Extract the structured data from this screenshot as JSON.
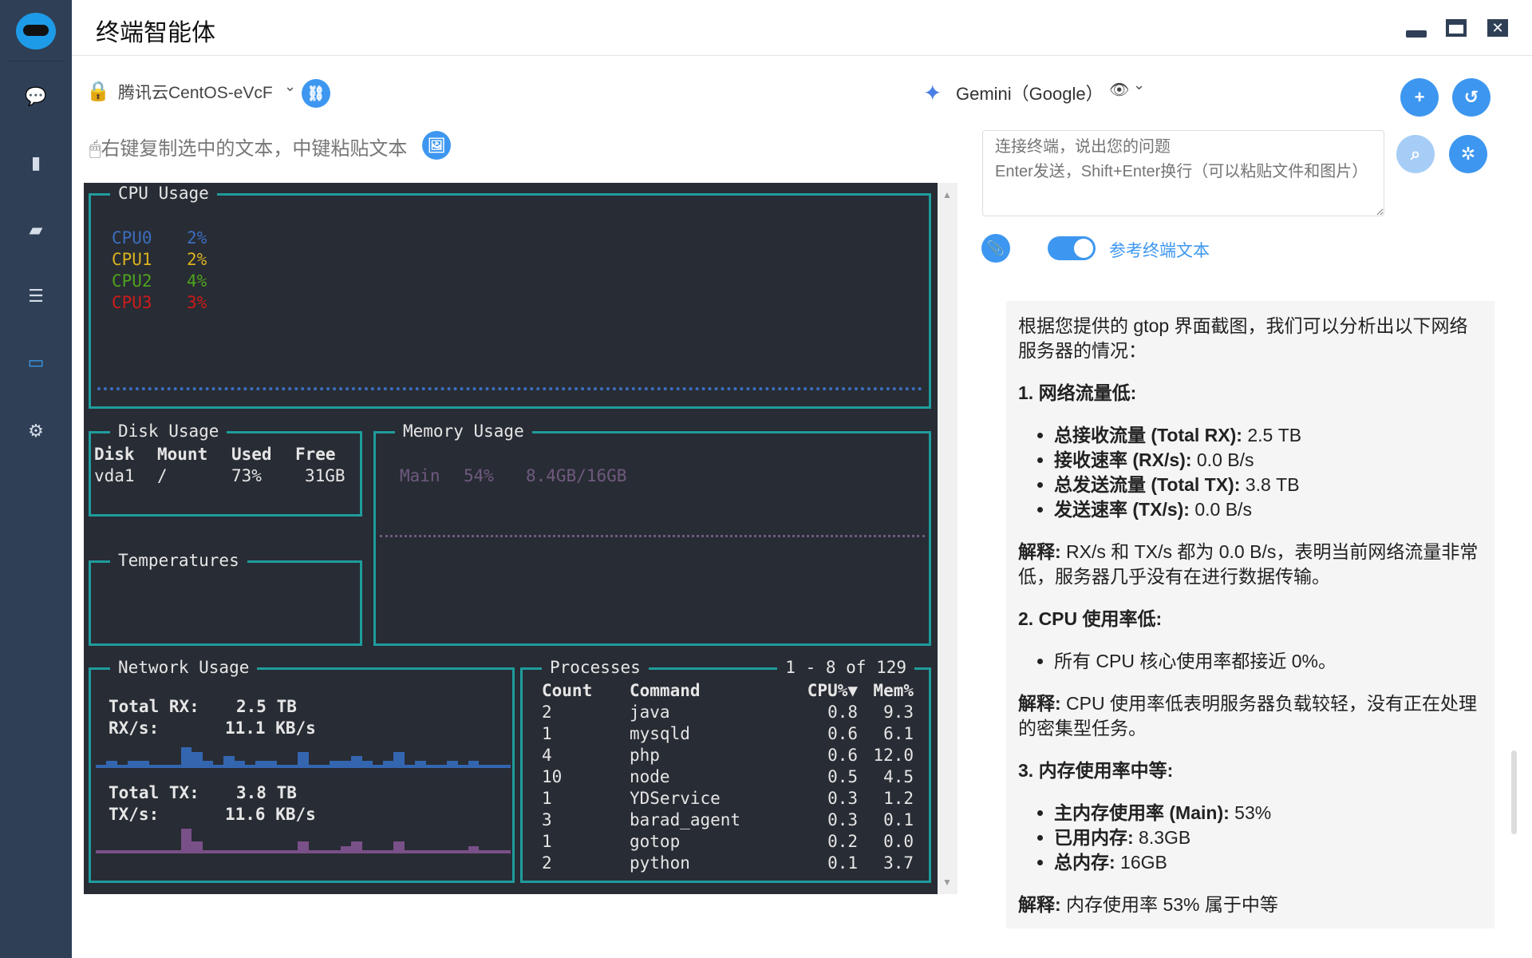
{
  "app": {
    "title": "终端智能体"
  },
  "sidebar": {
    "items": [
      {
        "name": "chat",
        "icon": "chat-icon",
        "glyph": "💬"
      },
      {
        "name": "file",
        "icon": "file-icon",
        "glyph": "▮"
      },
      {
        "name": "book",
        "icon": "book-icon",
        "glyph": "▰"
      },
      {
        "name": "database",
        "icon": "database-icon",
        "glyph": "☰"
      },
      {
        "name": "terminal",
        "icon": "monitor-icon",
        "glyph": "▭",
        "active": true
      },
      {
        "name": "settings",
        "icon": "gear-icon",
        "glyph": "⚙"
      }
    ]
  },
  "connection": {
    "server": "腾讯云CentOS-eVcF",
    "hint": "右键复制选中的文本，中键粘贴文本"
  },
  "model": {
    "name": "Gemini（Google）"
  },
  "input": {
    "placeholder": "连接终端，说出您的问题\nEnter发送，Shift+Enter换行（可以粘贴文件和图片）"
  },
  "toggle": {
    "label": "参考终端文本",
    "on": true
  },
  "terminal": {
    "cpu": {
      "title": "CPU Usage",
      "cores": [
        {
          "name": "CPU0",
          "pct": "2%",
          "color": "#3b6ebf"
        },
        {
          "name": "CPU1",
          "pct": "2%",
          "color": "#d9b21e"
        },
        {
          "name": "CPU2",
          "pct": "4%",
          "color": "#4fa31f"
        },
        {
          "name": "CPU3",
          "pct": "3%",
          "color": "#cc1b1b"
        }
      ]
    },
    "disk": {
      "title": "Disk Usage",
      "headers": [
        "Disk",
        "Mount",
        "Used",
        "Free"
      ],
      "row": [
        "vda1",
        "/",
        "73%",
        "31GB"
      ]
    },
    "temps": {
      "title": "Temperatures"
    },
    "memory": {
      "title": "Memory Usage",
      "label": "Main",
      "pct": "54%",
      "amount": "8.4GB/16GB"
    },
    "network": {
      "title": "Network Usage",
      "rx_total_label": "Total RX:",
      "rx_total": "2.5 TB",
      "rx_rate_label": "RX/s:",
      "rx_rate": "11.1 KB/s",
      "tx_total_label": "Total TX:",
      "tx_total": "3.8 TB",
      "tx_rate_label": "TX/s:",
      "tx_rate": "11.6 KB/s",
      "rx_spark": [
        0,
        1,
        0,
        1,
        1,
        0,
        0,
        0,
        4,
        3,
        1,
        0,
        2,
        1,
        0,
        1,
        1,
        0,
        0,
        3,
        0,
        0,
        1,
        1,
        2,
        1,
        0,
        1,
        3,
        0,
        1,
        0,
        0,
        1,
        0,
        1,
        0,
        0,
        0
      ],
      "tx_spark": [
        0,
        0,
        0,
        0,
        0,
        0,
        0,
        0,
        5,
        2,
        0,
        0,
        0,
        0,
        0,
        0,
        0,
        0,
        0,
        2,
        0,
        0,
        0,
        1,
        2,
        0,
        0,
        0,
        2,
        0,
        0,
        0,
        0,
        0,
        0,
        1,
        0,
        0,
        0
      ]
    },
    "processes": {
      "title": "Processes",
      "range": "1 - 8 of 129",
      "headers": [
        "Count",
        "Command",
        "CPU%▼",
        "Mem%"
      ],
      "rows": [
        [
          "2",
          "java",
          "0.8",
          "9.3"
        ],
        [
          "1",
          "mysqld",
          "0.6",
          "6.1"
        ],
        [
          "4",
          "php",
          "0.6",
          "12.0"
        ],
        [
          "10",
          "node",
          "0.5",
          "4.5"
        ],
        [
          "1",
          "YDService",
          "0.3",
          "1.2"
        ],
        [
          "3",
          "barad_agent",
          "0.3",
          "0.1"
        ],
        [
          "1",
          "gotop",
          "0.2",
          "0.0"
        ],
        [
          "2",
          "python",
          "0.1",
          "3.7"
        ]
      ]
    }
  },
  "response": {
    "intro": "根据您提供的 gtop 界面截图，我们可以分析出以下网络服务器的情况：",
    "s1": "1. 网络流量低:",
    "s1_items": [
      [
        "总接收流量 (Total RX):",
        " 2.5 TB"
      ],
      [
        "接收速率 (RX/s):",
        " 0.0 B/s"
      ],
      [
        "总发送流量 (Total TX):",
        " 3.8 TB"
      ],
      [
        "发送速率 (TX/s):",
        " 0.0 B/s"
      ]
    ],
    "s1_exp_label": "解释:",
    "s1_exp": " RX/s 和 TX/s 都为 0.0 B/s，表明当前网络流量非常低，服务器几乎没有在进行数据传输。",
    "s2": "2. CPU 使用率低:",
    "s2_item": "所有 CPU 核心使用率都接近 0%。",
    "s2_exp_label": "解释:",
    "s2_exp": " CPU 使用率低表明服务器负载较轻，没有正在处理的密集型任务。",
    "s3": "3. 内存使用率中等:",
    "s3_items": [
      [
        "主内存使用率 (Main):",
        " 53%"
      ],
      [
        "已用内存:",
        " 8.3GB"
      ],
      [
        "总内存:",
        " 16GB"
      ]
    ],
    "s3_exp_label": "解释:",
    "s3_exp": " 内存使用率 53% 属于中等"
  }
}
